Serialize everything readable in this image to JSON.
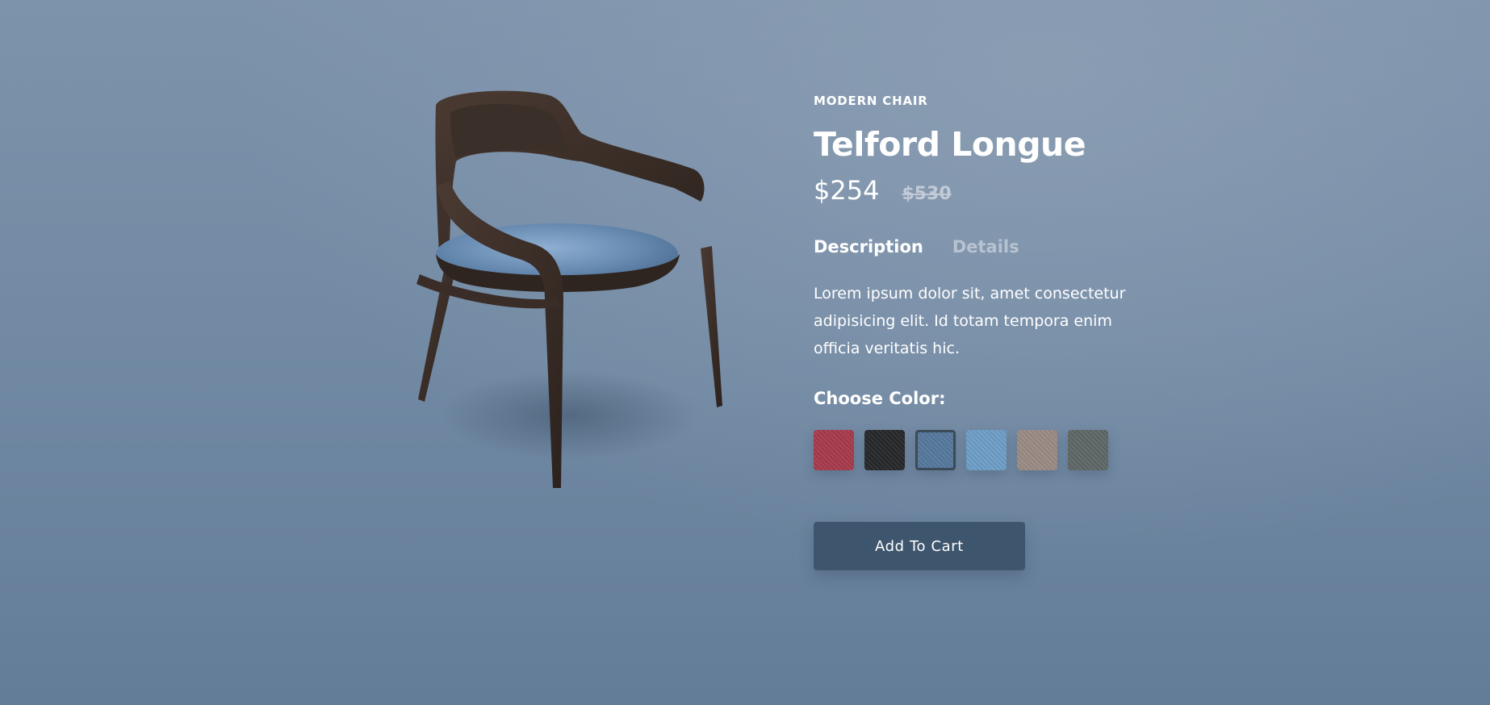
{
  "product": {
    "category": "MODERN CHAIR",
    "name": "Telford Longue",
    "price": "$254",
    "old_price": "$530"
  },
  "tabs": [
    {
      "label": "Description",
      "active": true
    },
    {
      "label": "Details",
      "active": false
    }
  ],
  "description": "Lorem ipsum dolor sit, amet consectetur adipisicing elit. Id totam tempora enim officia veritatis hic.",
  "color_picker": {
    "heading": "Choose Color:",
    "swatches": [
      {
        "color": "#a63a4c",
        "selected": false
      },
      {
        "color": "#262729",
        "selected": false
      },
      {
        "color": "#55789c",
        "selected": true
      },
      {
        "color": "#6e9dc6",
        "selected": false
      },
      {
        "color": "#9a8a84",
        "selected": false
      },
      {
        "color": "#5f6766",
        "selected": false
      }
    ]
  },
  "actions": {
    "add_to_cart_label": "Add To Cart"
  },
  "colors": {
    "accent_button": "#3e556e",
    "muted_text": "#b8c3d1",
    "background_top": "#7d93ab",
    "background_bottom": "#637c98"
  }
}
